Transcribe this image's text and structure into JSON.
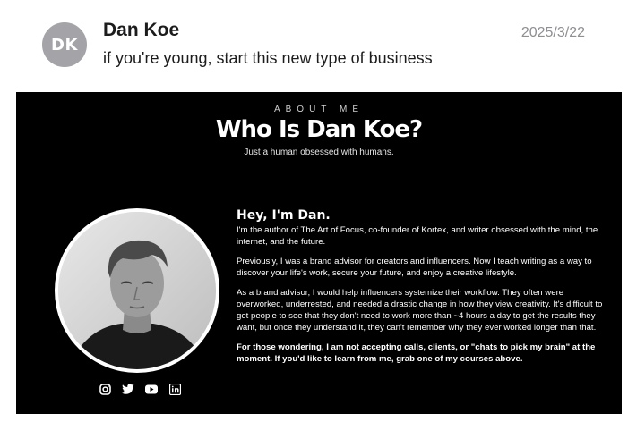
{
  "email": {
    "avatar_initials": "DK",
    "sender": "Dan Koe",
    "date": "2025/3/22",
    "subject": "if you're young, start this new type of business"
  },
  "banner": {
    "eyebrow": "ABOUT ME",
    "title": "Who Is Dan Koe?",
    "tagline": "Just a human obsessed with humans.",
    "greeting": "Hey, I'm Dan.",
    "paragraphs": [
      "I'm the author of The Art of Focus, co-founder of Kortex, and writer obsessed with the mind, the internet, and the future.",
      "Previously, I was a brand advisor for creators and influencers. Now I teach writing as a way to discover your life's work, secure your future, and enjoy a creative lifestyle.",
      "As a brand advisor, I would help influencers systemize their workflow. They often were overworked, underrested, and needed a drastic change in how they view creativity. It's difficult to get people to see that they don't need to work more than ~4 hours a day to get the results they want, but once they understand it, they can't remember why they ever worked longer than that.",
      "For those wondering, I am not accepting calls, clients, or \"chats to pick my brain\" at the moment. If you'd like to learn from me, grab one of my courses above."
    ],
    "socials": [
      "instagram-icon",
      "twitter-icon",
      "youtube-icon",
      "linkedin-icon"
    ]
  },
  "colors": {
    "avatar_bg": "#a3a3a8",
    "banner_bg": "#000000",
    "date_text": "#8e8e93"
  }
}
